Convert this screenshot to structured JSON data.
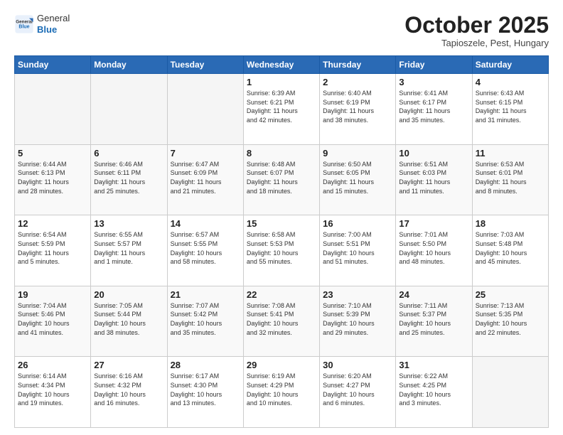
{
  "header": {
    "logo_general": "General",
    "logo_blue": "Blue",
    "month": "October 2025",
    "location": "Tapioszele, Pest, Hungary"
  },
  "days_of_week": [
    "Sunday",
    "Monday",
    "Tuesday",
    "Wednesday",
    "Thursday",
    "Friday",
    "Saturday"
  ],
  "weeks": [
    [
      {
        "day": "",
        "info": ""
      },
      {
        "day": "",
        "info": ""
      },
      {
        "day": "",
        "info": ""
      },
      {
        "day": "1",
        "info": "Sunrise: 6:39 AM\nSunset: 6:21 PM\nDaylight: 11 hours\nand 42 minutes."
      },
      {
        "day": "2",
        "info": "Sunrise: 6:40 AM\nSunset: 6:19 PM\nDaylight: 11 hours\nand 38 minutes."
      },
      {
        "day": "3",
        "info": "Sunrise: 6:41 AM\nSunset: 6:17 PM\nDaylight: 11 hours\nand 35 minutes."
      },
      {
        "day": "4",
        "info": "Sunrise: 6:43 AM\nSunset: 6:15 PM\nDaylight: 11 hours\nand 31 minutes."
      }
    ],
    [
      {
        "day": "5",
        "info": "Sunrise: 6:44 AM\nSunset: 6:13 PM\nDaylight: 11 hours\nand 28 minutes."
      },
      {
        "day": "6",
        "info": "Sunrise: 6:46 AM\nSunset: 6:11 PM\nDaylight: 11 hours\nand 25 minutes."
      },
      {
        "day": "7",
        "info": "Sunrise: 6:47 AM\nSunset: 6:09 PM\nDaylight: 11 hours\nand 21 minutes."
      },
      {
        "day": "8",
        "info": "Sunrise: 6:48 AM\nSunset: 6:07 PM\nDaylight: 11 hours\nand 18 minutes."
      },
      {
        "day": "9",
        "info": "Sunrise: 6:50 AM\nSunset: 6:05 PM\nDaylight: 11 hours\nand 15 minutes."
      },
      {
        "day": "10",
        "info": "Sunrise: 6:51 AM\nSunset: 6:03 PM\nDaylight: 11 hours\nand 11 minutes."
      },
      {
        "day": "11",
        "info": "Sunrise: 6:53 AM\nSunset: 6:01 PM\nDaylight: 11 hours\nand 8 minutes."
      }
    ],
    [
      {
        "day": "12",
        "info": "Sunrise: 6:54 AM\nSunset: 5:59 PM\nDaylight: 11 hours\nand 5 minutes."
      },
      {
        "day": "13",
        "info": "Sunrise: 6:55 AM\nSunset: 5:57 PM\nDaylight: 11 hours\nand 1 minute."
      },
      {
        "day": "14",
        "info": "Sunrise: 6:57 AM\nSunset: 5:55 PM\nDaylight: 10 hours\nand 58 minutes."
      },
      {
        "day": "15",
        "info": "Sunrise: 6:58 AM\nSunset: 5:53 PM\nDaylight: 10 hours\nand 55 minutes."
      },
      {
        "day": "16",
        "info": "Sunrise: 7:00 AM\nSunset: 5:51 PM\nDaylight: 10 hours\nand 51 minutes."
      },
      {
        "day": "17",
        "info": "Sunrise: 7:01 AM\nSunset: 5:50 PM\nDaylight: 10 hours\nand 48 minutes."
      },
      {
        "day": "18",
        "info": "Sunrise: 7:03 AM\nSunset: 5:48 PM\nDaylight: 10 hours\nand 45 minutes."
      }
    ],
    [
      {
        "day": "19",
        "info": "Sunrise: 7:04 AM\nSunset: 5:46 PM\nDaylight: 10 hours\nand 41 minutes."
      },
      {
        "day": "20",
        "info": "Sunrise: 7:05 AM\nSunset: 5:44 PM\nDaylight: 10 hours\nand 38 minutes."
      },
      {
        "day": "21",
        "info": "Sunrise: 7:07 AM\nSunset: 5:42 PM\nDaylight: 10 hours\nand 35 minutes."
      },
      {
        "day": "22",
        "info": "Sunrise: 7:08 AM\nSunset: 5:41 PM\nDaylight: 10 hours\nand 32 minutes."
      },
      {
        "day": "23",
        "info": "Sunrise: 7:10 AM\nSunset: 5:39 PM\nDaylight: 10 hours\nand 29 minutes."
      },
      {
        "day": "24",
        "info": "Sunrise: 7:11 AM\nSunset: 5:37 PM\nDaylight: 10 hours\nand 25 minutes."
      },
      {
        "day": "25",
        "info": "Sunrise: 7:13 AM\nSunset: 5:35 PM\nDaylight: 10 hours\nand 22 minutes."
      }
    ],
    [
      {
        "day": "26",
        "info": "Sunrise: 6:14 AM\nSunset: 4:34 PM\nDaylight: 10 hours\nand 19 minutes."
      },
      {
        "day": "27",
        "info": "Sunrise: 6:16 AM\nSunset: 4:32 PM\nDaylight: 10 hours\nand 16 minutes."
      },
      {
        "day": "28",
        "info": "Sunrise: 6:17 AM\nSunset: 4:30 PM\nDaylight: 10 hours\nand 13 minutes."
      },
      {
        "day": "29",
        "info": "Sunrise: 6:19 AM\nSunset: 4:29 PM\nDaylight: 10 hours\nand 10 minutes."
      },
      {
        "day": "30",
        "info": "Sunrise: 6:20 AM\nSunset: 4:27 PM\nDaylight: 10 hours\nand 6 minutes."
      },
      {
        "day": "31",
        "info": "Sunrise: 6:22 AM\nSunset: 4:25 PM\nDaylight: 10 hours\nand 3 minutes."
      },
      {
        "day": "",
        "info": ""
      }
    ]
  ]
}
